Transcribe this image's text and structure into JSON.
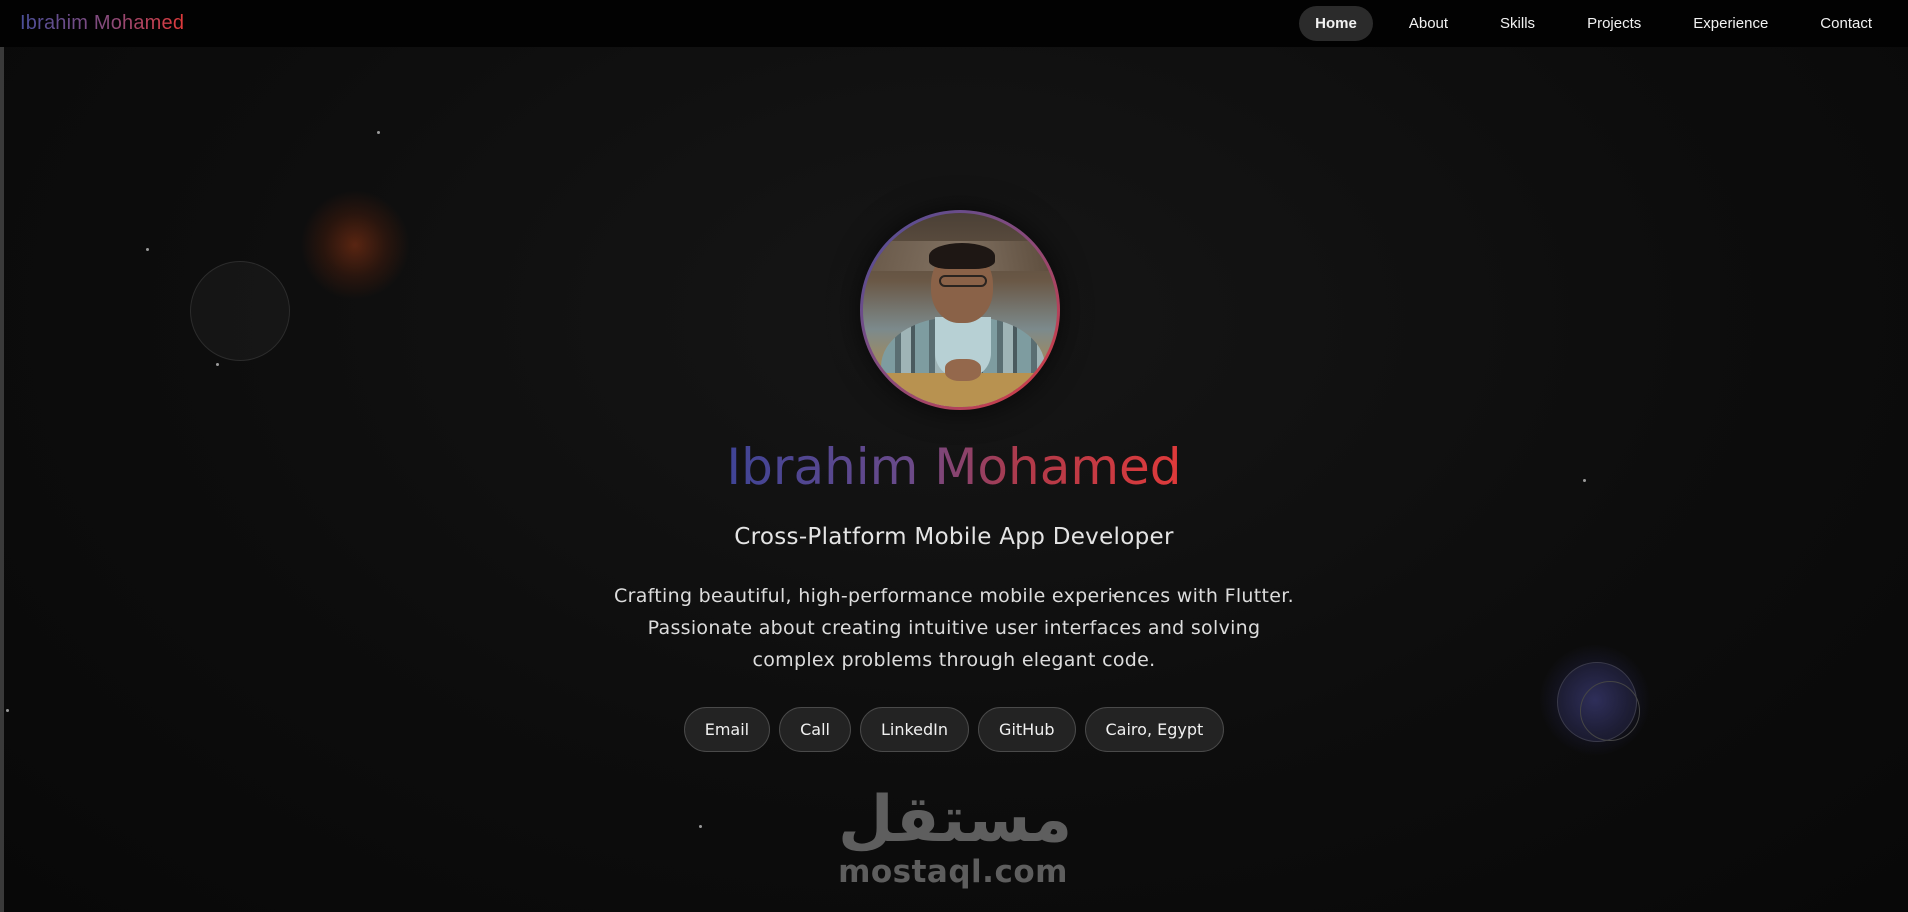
{
  "nav": {
    "brand": "Ibrahim Mohamed",
    "links": [
      {
        "label": "Home",
        "active": true
      },
      {
        "label": "About",
        "active": false
      },
      {
        "label": "Skills",
        "active": false
      },
      {
        "label": "Projects",
        "active": false
      },
      {
        "label": "Experience",
        "active": false
      },
      {
        "label": "Contact",
        "active": false
      }
    ]
  },
  "hero": {
    "name": "Ibrahim Mohamed",
    "title": "Cross-Platform Mobile App Developer",
    "description": "Crafting beautiful, high-performance mobile experiences with Flutter. Passionate about creating intuitive user interfaces and solving complex problems through elegant code.",
    "chips": [
      "Email",
      "Call",
      "LinkedIn",
      "GitHub",
      "Cairo, Egypt"
    ]
  },
  "watermark": {
    "arabic": "مستقل",
    "latin": "mostaql.com"
  },
  "colors": {
    "gradient_start": "#4a4f9a",
    "gradient_end": "#e03a3a",
    "background": "#0b0b0b",
    "nav_background": "#020202"
  }
}
